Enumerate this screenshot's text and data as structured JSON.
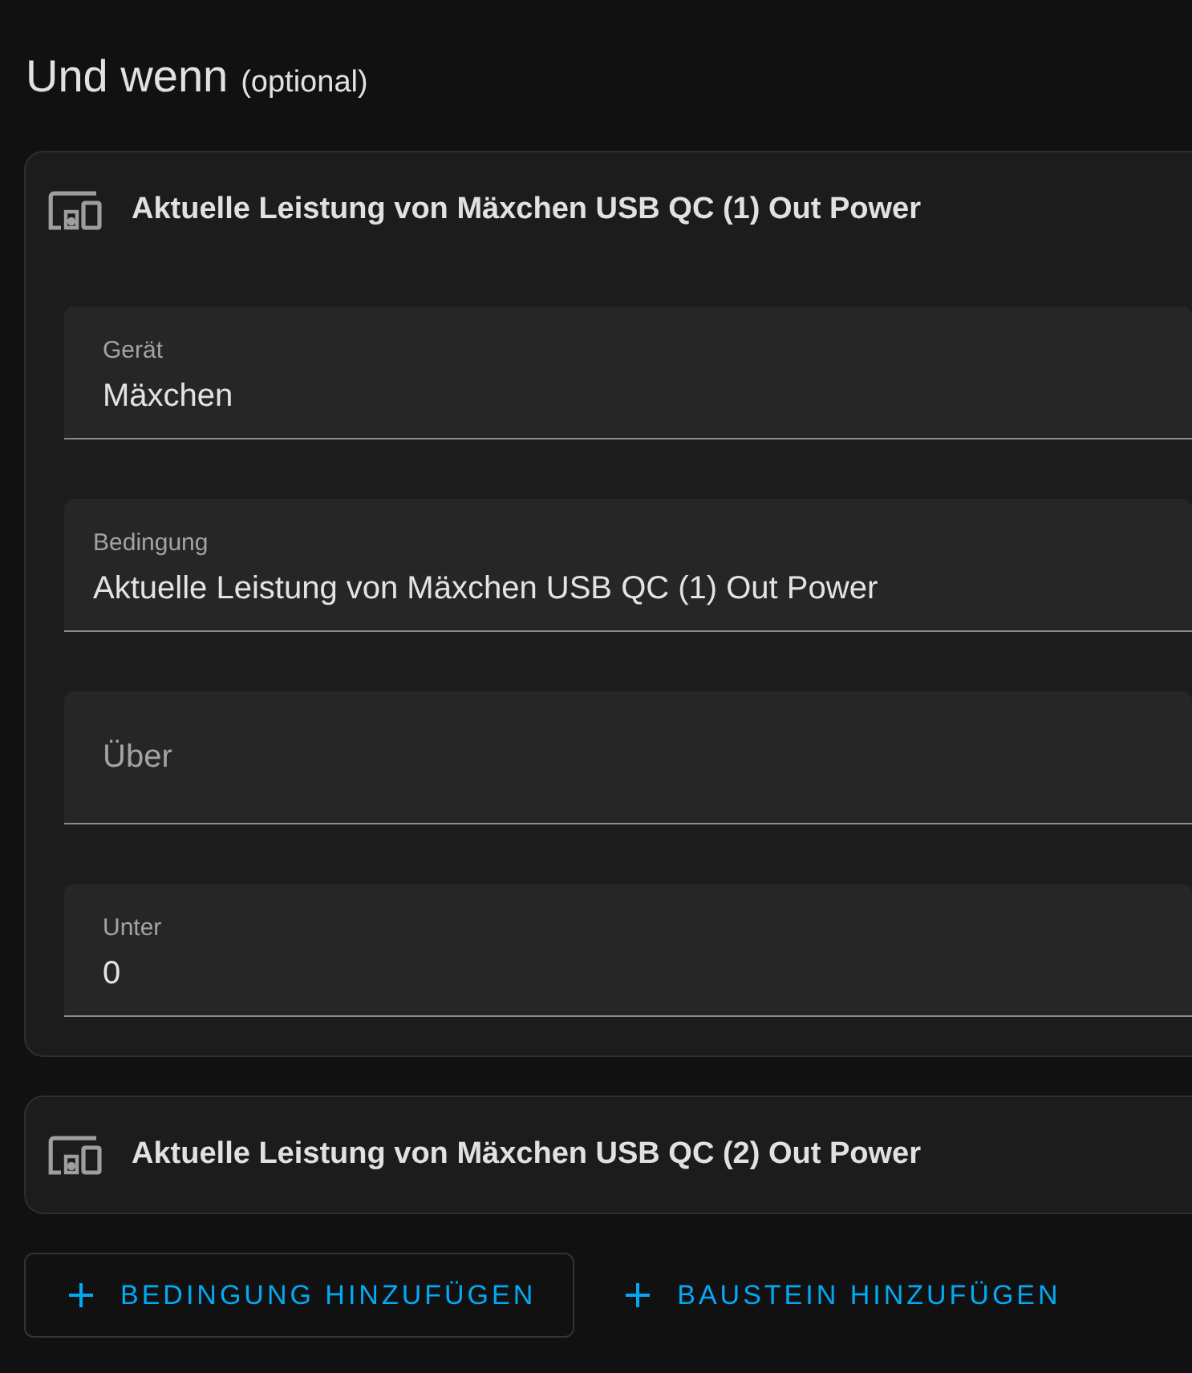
{
  "heading": {
    "title": "Und wenn",
    "note": "(optional)"
  },
  "conditions": [
    {
      "title": "Aktuelle Leistung von Mäxchen USB QC (1) Out Power",
      "fields": [
        {
          "kind": "picker",
          "label": "Gerät",
          "value": "Mäxchen"
        },
        {
          "kind": "select",
          "label": "Bedingung",
          "value": "Aktuelle Leistung von Mäxchen USB QC (1) Out Power"
        },
        {
          "kind": "number",
          "label": "Über"
        },
        {
          "kind": "number",
          "label": "Unter",
          "value": "0"
        }
      ]
    },
    {
      "title": "Aktuelle Leistung von Mäxchen USB QC (2) Out Power"
    }
  ],
  "actions": [
    {
      "kind": "outlined",
      "label": "BEDINGUNG HINZUFÜGEN"
    },
    {
      "kind": "text",
      "label": "BAUSTEIN HINZUFÜGEN"
    }
  ]
}
